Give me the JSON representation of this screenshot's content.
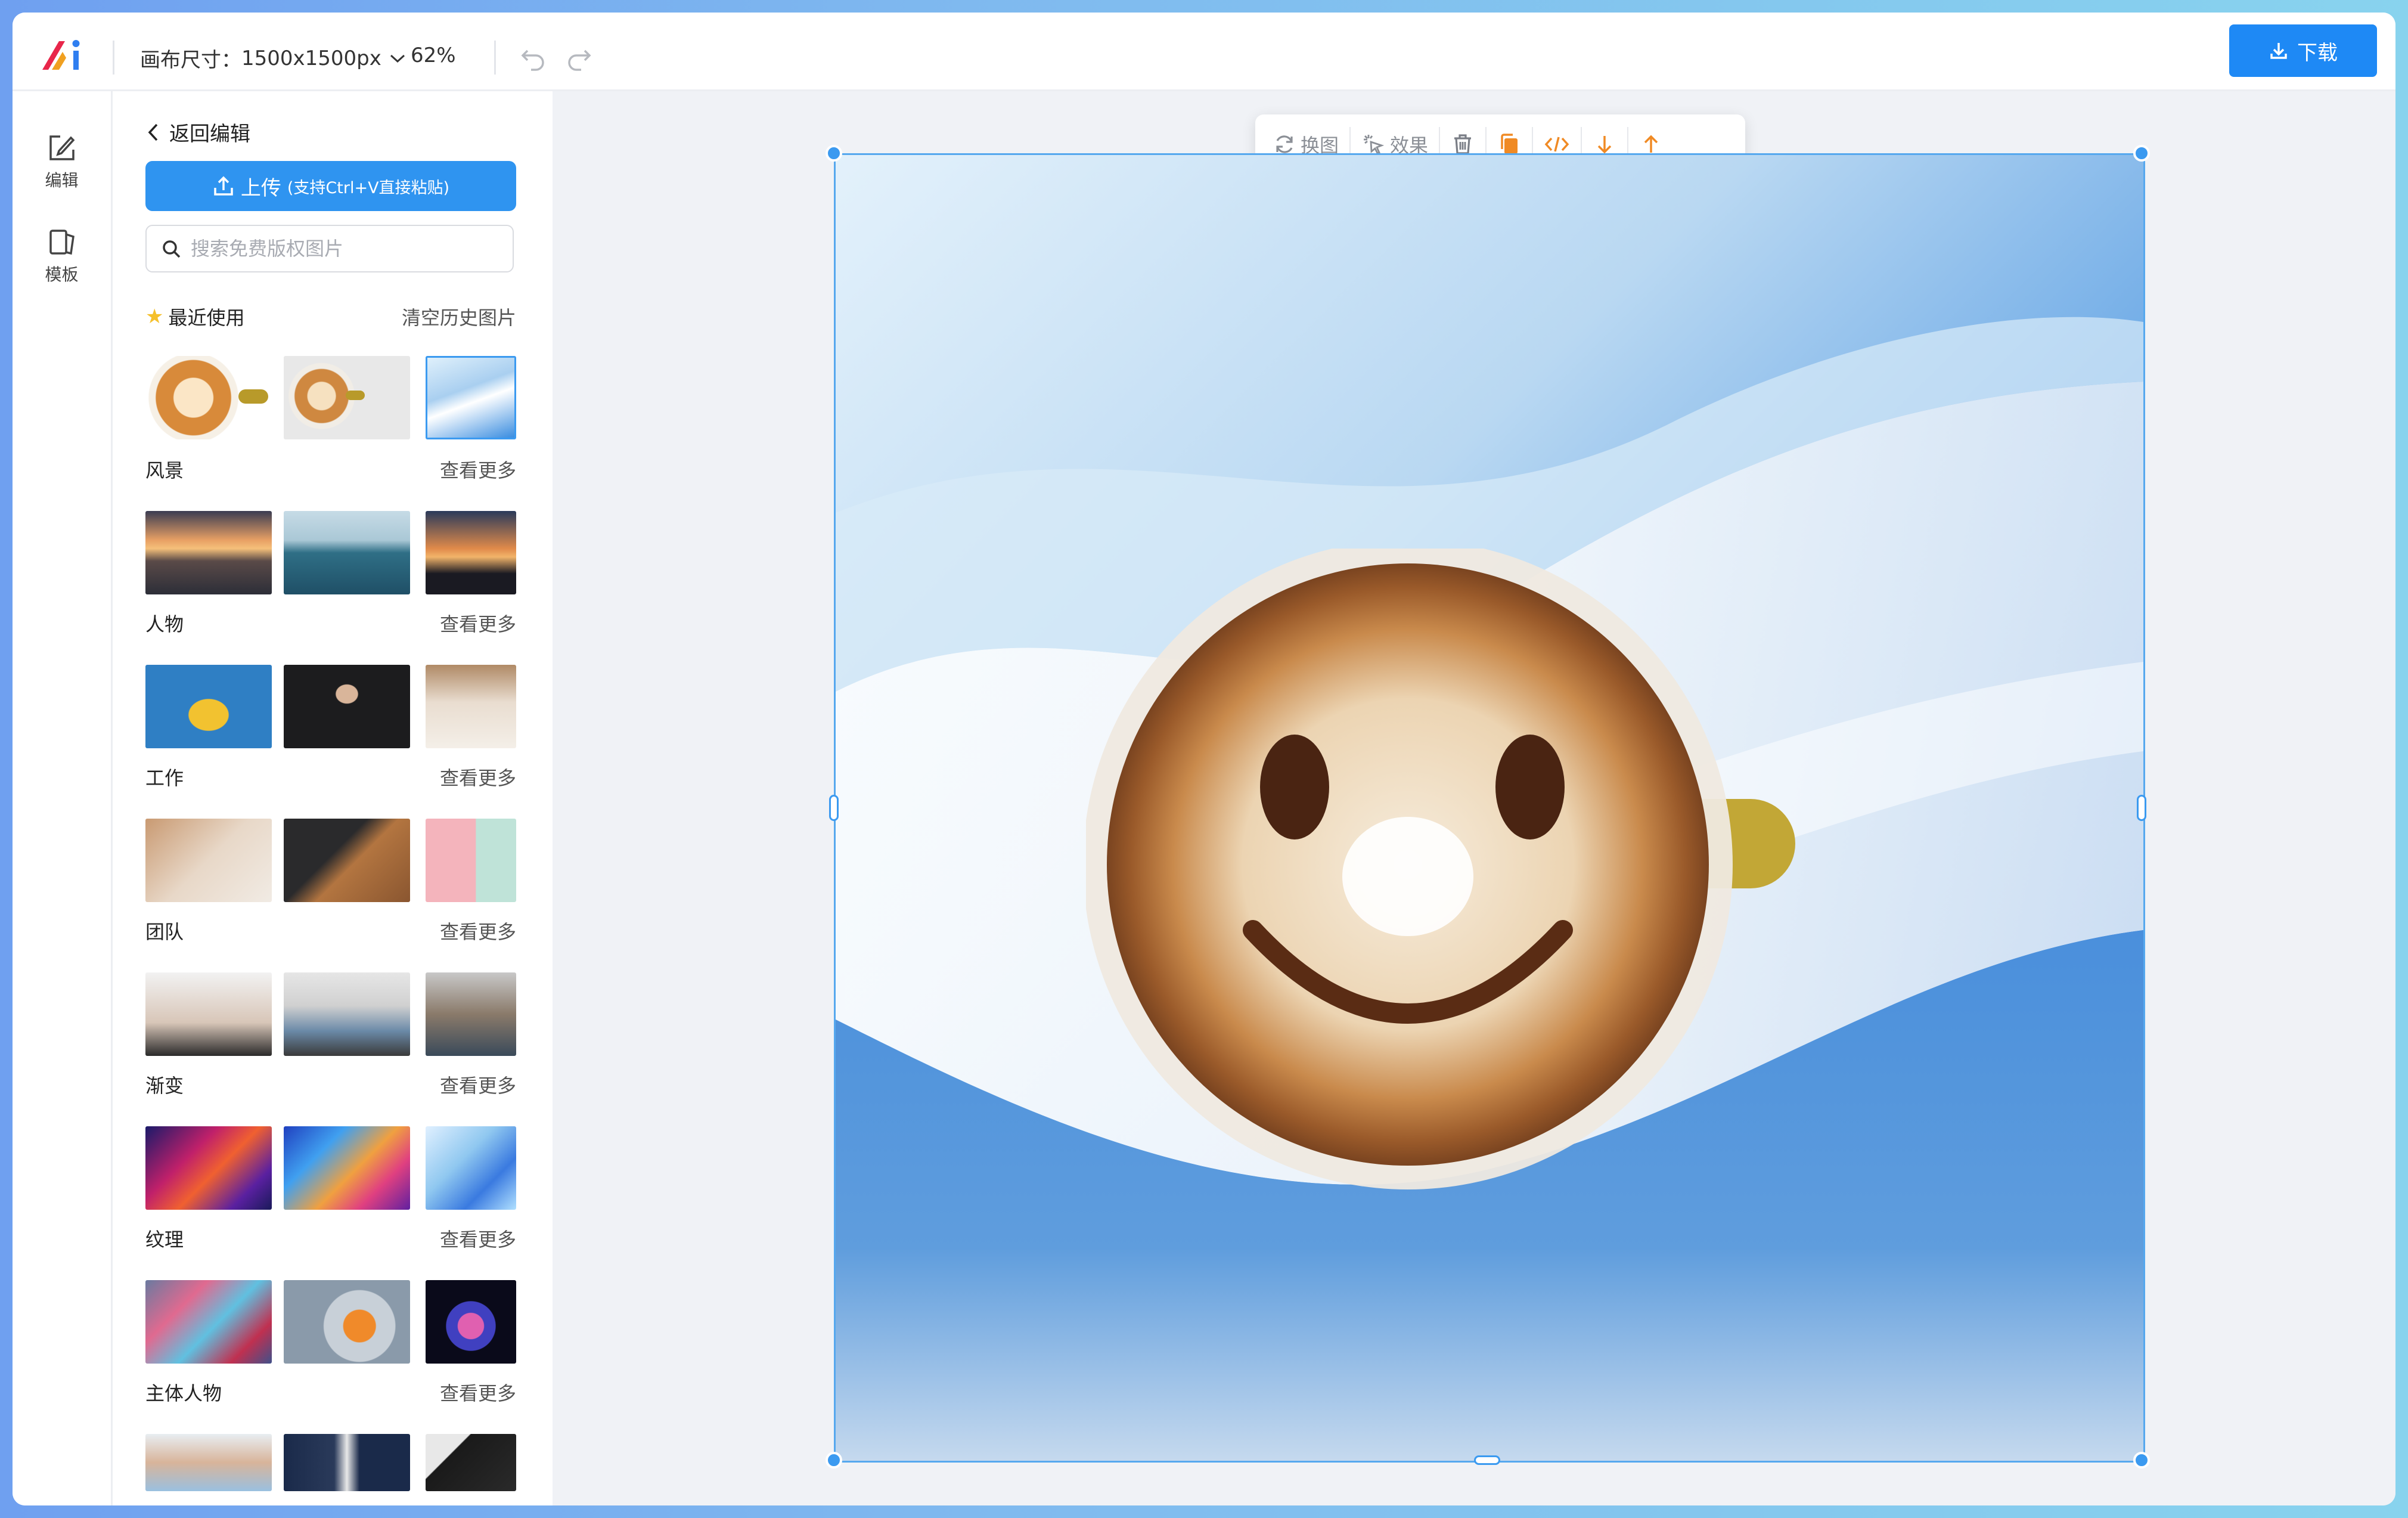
{
  "header": {
    "canvas_size_label": "画布尺寸：",
    "canvas_size_value": "1500x1500px",
    "zoom": "62%",
    "download_label": "下载"
  },
  "rail": {
    "items": [
      {
        "label": "编辑",
        "icon": "edit-icon"
      },
      {
        "label": "模板",
        "icon": "template-icon"
      }
    ]
  },
  "panel": {
    "back_label": "返回编辑",
    "upload_label": "上传",
    "upload_hint": "(支持Ctrl+V直接粘贴)",
    "search_placeholder": "搜索免费版权图片",
    "recent": {
      "title": "最近使用",
      "action": "清空历史图片"
    },
    "sections": [
      {
        "title": "风景",
        "more": "查看更多"
      },
      {
        "title": "人物",
        "more": "查看更多"
      },
      {
        "title": "工作",
        "more": "查看更多"
      },
      {
        "title": "团队",
        "more": "查看更多"
      },
      {
        "title": "渐变",
        "more": "查看更多"
      },
      {
        "title": "纹理",
        "more": "查看更多"
      },
      {
        "title": "主体人物",
        "more": "查看更多"
      }
    ]
  },
  "toolbar": {
    "replace_label": "换图",
    "effect_label": "效果"
  },
  "colors": {
    "accent": "#1e89f5",
    "selection": "#56a8ee",
    "tool_orange": "#f08a24"
  }
}
